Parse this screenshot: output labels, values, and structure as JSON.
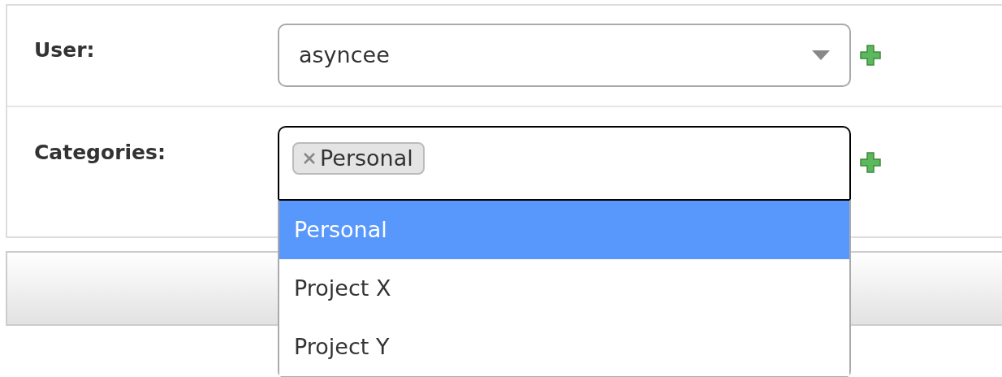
{
  "fields": [
    {
      "kind": "select",
      "label": "User:",
      "value": "asyncee"
    },
    {
      "kind": "multiselect",
      "label": "Categories:",
      "tags": [
        "Personal"
      ],
      "options": [
        {
          "label": "Personal",
          "selected": true
        },
        {
          "label": "Project X",
          "selected": false
        },
        {
          "label": "Project Y",
          "selected": false
        }
      ]
    }
  ]
}
